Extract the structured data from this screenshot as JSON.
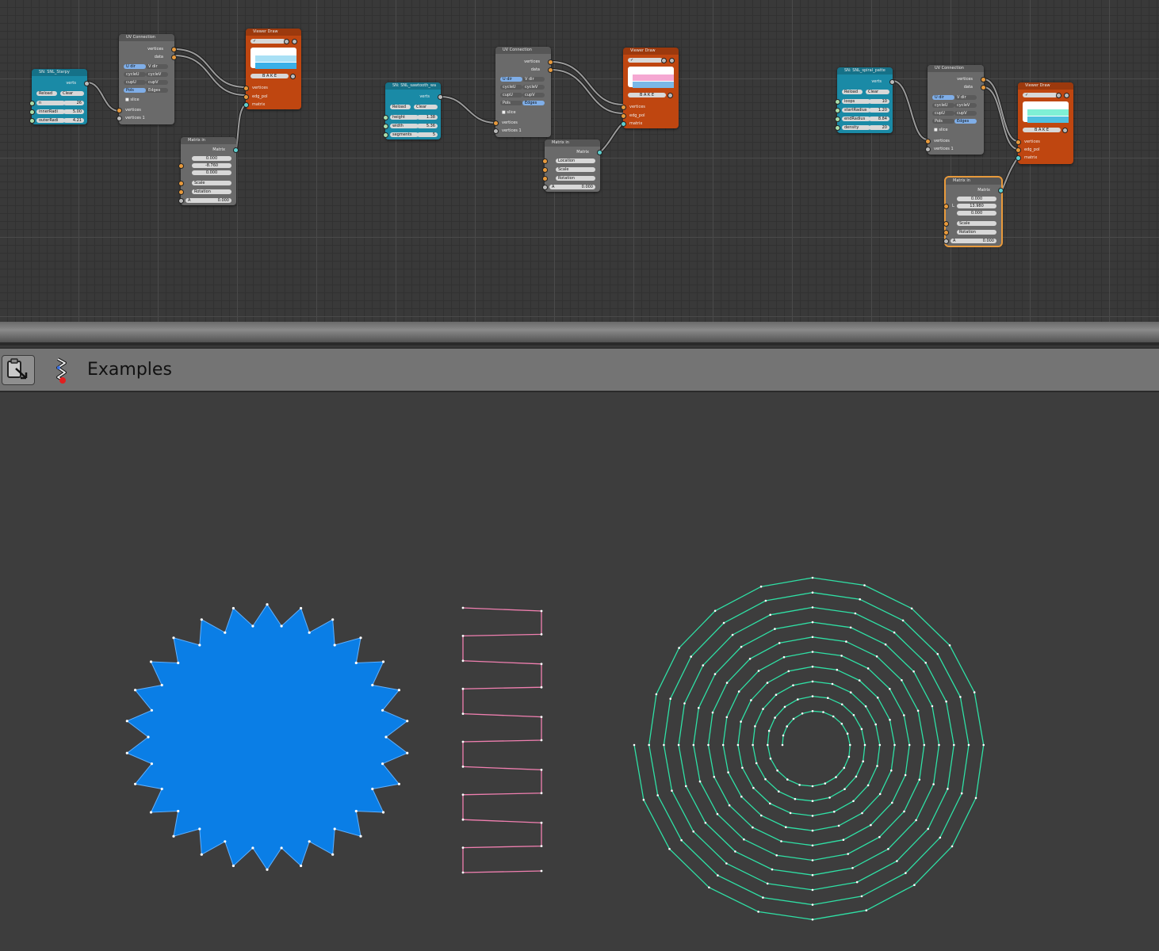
{
  "header": {
    "title": "Examples",
    "editor_type_icon": "clipboard-arrow-icon",
    "tree_icon": "sverchok-node-tree-icon"
  },
  "colors": {
    "star_fill": "#0a7ee6",
    "sawtooth_line": "#f07fb0",
    "spiral_line": "#2fe0a5",
    "vertex": "#ffffff"
  },
  "nodes": {
    "starpy": {
      "title": "SN: SNL_Starpy",
      "out": "verts",
      "reload": "Reload",
      "clear": "Clear",
      "fields": [
        {
          "label": "n",
          "value": "26"
        },
        {
          "label": "innerRadi",
          "value": "5.00"
        },
        {
          "label": "outerRadi",
          "value": "4.21"
        }
      ]
    },
    "sawtooth": {
      "title": "SN: SNL_sawtooth_wa",
      "out": "verts",
      "reload": "Reload",
      "clear": "Clear",
      "fields": [
        {
          "label": "height",
          "value": "1.38"
        },
        {
          "label": "width",
          "value": "5.36"
        },
        {
          "label": "segments",
          "value": "5"
        }
      ]
    },
    "spiral": {
      "title": "SN: SNL_spiral_patte",
      "out": "verts",
      "reload": "Reload",
      "clear": "Clear",
      "fields": [
        {
          "label": "loops",
          "value": "10"
        },
        {
          "label": "startRadius",
          "value": "1.20"
        },
        {
          "label": "endRadius",
          "value": "8.84"
        },
        {
          "label": "density",
          "value": "20"
        }
      ]
    },
    "uv": {
      "title": "UV Connection",
      "out1": "vertices",
      "out2": "data",
      "udir": "U dir",
      "vdir": "V dir",
      "cycleu": "cycleU",
      "cyclev": "cycleV",
      "cupu": "cupU",
      "cupv": "cupV",
      "pols": "Pols",
      "edges": "Edges",
      "slice": "slice",
      "in1": "vertices",
      "in2": "vertices 1"
    },
    "viewer": {
      "title": "Viewer Draw",
      "bake": "B A K E",
      "in1": "vertices",
      "in2": "edg_pol",
      "in3": "matrix"
    },
    "matrix1": {
      "title": "Matrix in",
      "out": "Matrix",
      "loc": [
        "0.000",
        "-8.760",
        "0.000"
      ],
      "scale": "Scale",
      "rotation": "Rotation",
      "angle_label": "A",
      "angle": "0.000"
    },
    "matrix2": {
      "title": "Matrix in",
      "out": "Matrix",
      "location": "Location",
      "scale": "Scale",
      "rotation": "Rotation",
      "angle_label": "A",
      "angle": "0.000"
    },
    "matrix3": {
      "title": "Matrix in",
      "out": "Matrix",
      "loc_label": "L",
      "loc": [
        "0.000",
        "13.980",
        "0.000"
      ],
      "scale": "Scale",
      "rotation": "Rotation",
      "angle_label": "A",
      "angle": "0.000"
    }
  }
}
